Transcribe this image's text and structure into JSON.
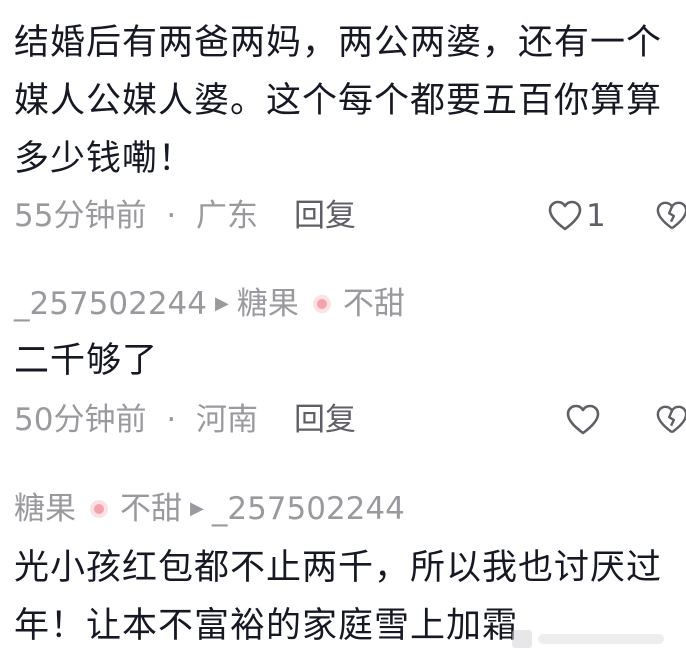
{
  "comments": [
    {
      "text": "结婚后有两爸两妈，两公两婆，还有一个媒人公媒人婆。这个每个都要五百你算算多少钱嘞！",
      "time": "55分钟前",
      "separator": "·",
      "location": "广东",
      "reply_label": "回复",
      "like_count": "1"
    },
    {
      "author": "_257502244",
      "reply_to_name": "糖果",
      "reply_to_suffix": "不甜",
      "text": "二千够了",
      "time": "50分钟前",
      "separator": "·",
      "location": "河南",
      "reply_label": "回复",
      "like_count": ""
    },
    {
      "author_name": "糖果",
      "author_suffix": "不甜",
      "reply_to": "_257502244",
      "text": "光小孩红包都不止两千，所以我也讨厌过年！让本不富裕的家庭雪上加霜"
    }
  ],
  "icons": {
    "like": "heart-outline-icon",
    "dislike": "broken-heart-icon",
    "reply_arrow": "triangle-right-icon",
    "emoji": "candy-emoji-icon"
  },
  "colors": {
    "text": "#161823",
    "meta": "#9a9a9e",
    "action": "#5f5f66",
    "emoji": "#f4a3ad"
  }
}
